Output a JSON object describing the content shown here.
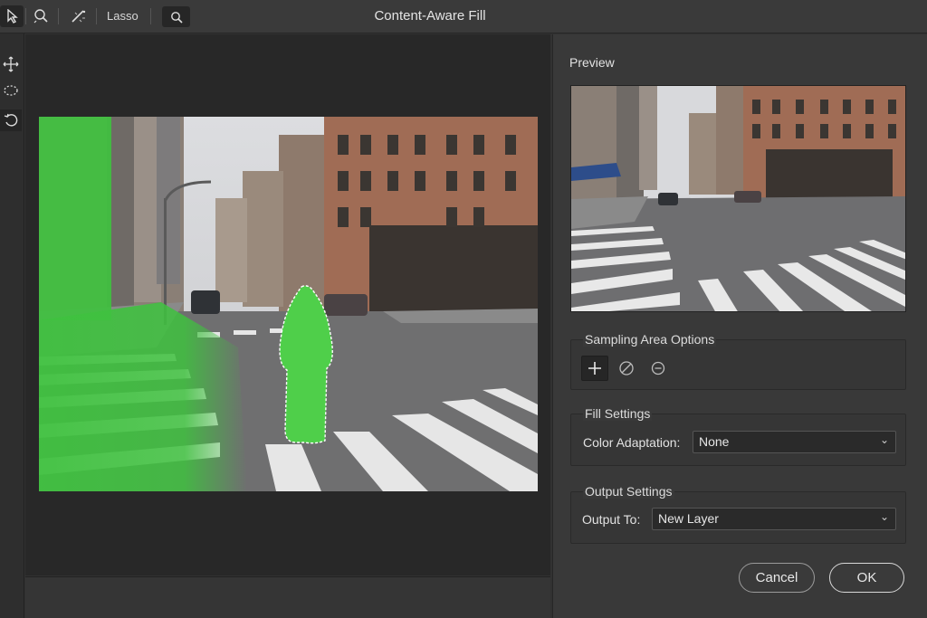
{
  "window": {
    "title": "Content-Aware Fill"
  },
  "toolbar": {
    "tools": [
      {
        "icon": "selection-arrow-icon"
      },
      {
        "icon": "quick-selection-icon"
      },
      {
        "icon": "magic-brush-icon"
      }
    ],
    "lasso_label": "Lasso",
    "search_icon": "search-icon"
  },
  "side_tools": [
    {
      "icon": "move-icon"
    },
    {
      "icon": "lasso-select-icon"
    },
    {
      "icon": "rotate-icon"
    }
  ],
  "preview": {
    "title": "Preview"
  },
  "sampling": {
    "title": "Sampling Area Options",
    "buttons": [
      {
        "icon": "add-icon",
        "active": true
      },
      {
        "icon": "brush-icon",
        "active": false
      },
      {
        "icon": "subtract-icon",
        "active": false
      }
    ]
  },
  "fill_settings": {
    "title": "Fill Settings",
    "color_adaptation_label": "Color Adaptation:",
    "color_adaptation_value": "None"
  },
  "output_settings": {
    "title": "Output Settings",
    "output_to_label": "Output To:",
    "output_to_value": "New Layer"
  },
  "buttons": {
    "cancel": "Cancel",
    "ok": "OK"
  },
  "colors": {
    "accent_green": "#3fbf3f",
    "panel_bg": "#393939",
    "canvas_bg": "#282828"
  }
}
